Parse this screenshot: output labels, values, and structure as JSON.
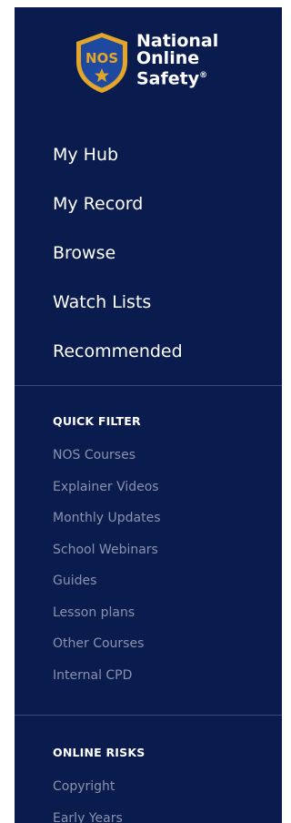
{
  "brand": {
    "badge_text": "NOS",
    "name_line1": "National",
    "name_line2": "Online",
    "name_line3": "Safety",
    "registered_mark": "®",
    "colors": {
      "shield_gold": "#e3a52a",
      "shield_blue": "#1d4aa0",
      "sidebar_bg": "#0a1b4d"
    }
  },
  "nav": {
    "items": [
      {
        "label": "My Hub"
      },
      {
        "label": "My Record"
      },
      {
        "label": "Browse"
      },
      {
        "label": "Watch Lists"
      },
      {
        "label": "Recommended"
      }
    ]
  },
  "quick_filter": {
    "title": "QUICK FILTER",
    "items": [
      {
        "label": "NOS Courses"
      },
      {
        "label": "Explainer Videos"
      },
      {
        "label": "Monthly Updates"
      },
      {
        "label": "School Webinars"
      },
      {
        "label": "Guides"
      },
      {
        "label": "Lesson plans"
      },
      {
        "label": "Other Courses"
      },
      {
        "label": "Internal CPD"
      }
    ]
  },
  "online_risks": {
    "title": "ONLINE RISKS",
    "items": [
      {
        "label": "Copyright"
      },
      {
        "label": "Early Years"
      }
    ]
  }
}
